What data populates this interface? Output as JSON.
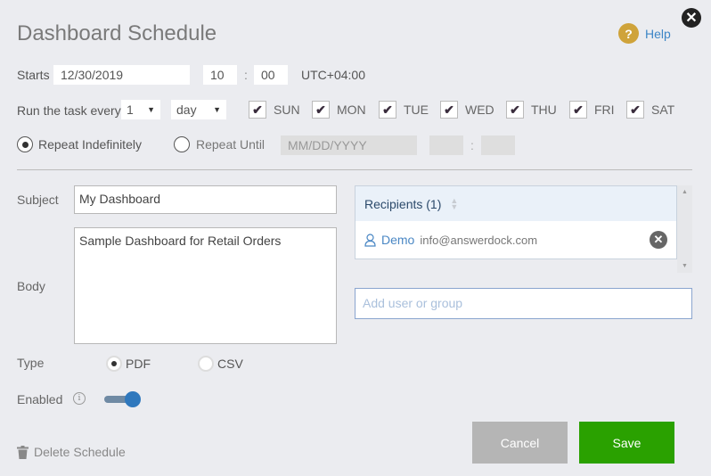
{
  "dialog": {
    "title": "Dashboard Schedule",
    "help_label": "Help",
    "help_icon": "question-circle-icon",
    "close_icon": "close-circle-icon"
  },
  "starts": {
    "label": "Starts",
    "date": "12/30/2019",
    "hour": "10",
    "separator": ":",
    "minute": "00",
    "timezone": "UTC+04:00"
  },
  "run": {
    "label": "Run the task every",
    "interval": "1",
    "unit": "day",
    "days": [
      {
        "label": "SUN",
        "checked": true
      },
      {
        "label": "MON",
        "checked": true
      },
      {
        "label": "TUE",
        "checked": true
      },
      {
        "label": "WED",
        "checked": true
      },
      {
        "label": "THU",
        "checked": true
      },
      {
        "label": "FRI",
        "checked": true
      },
      {
        "label": "SAT",
        "checked": true
      }
    ],
    "check_glyph": "✔"
  },
  "repeat": {
    "indefinitely_label": "Repeat Indefinitely",
    "until_label": "Repeat Until",
    "selected": "indefinitely",
    "until_date_placeholder": "MM/DD/YYYY",
    "until_hour": "",
    "until_minute": "",
    "separator": ":"
  },
  "email": {
    "subject_label": "Subject",
    "subject_value": "My Dashboard",
    "body_label": "Body",
    "body_value": "Sample Dashboard for Retail Orders",
    "type_label": "Type",
    "type_options": [
      "PDF",
      "CSV"
    ],
    "type_selected": "PDF",
    "enabled_label": "Enabled",
    "enabled": true
  },
  "recipients": {
    "header": "Recipients (1)",
    "items": [
      {
        "name": "Demo",
        "email": "info@answerdock.com"
      }
    ],
    "add_placeholder": "Add user or group"
  },
  "footer": {
    "delete_label": "Delete Schedule",
    "cancel_label": "Cancel",
    "save_label": "Save"
  },
  "colors": {
    "save": "#2aa100",
    "cancel": "#b5b5b5",
    "help_icon": "#cfa33a",
    "link": "#3d86c6",
    "toggle": "#2f78bd"
  }
}
